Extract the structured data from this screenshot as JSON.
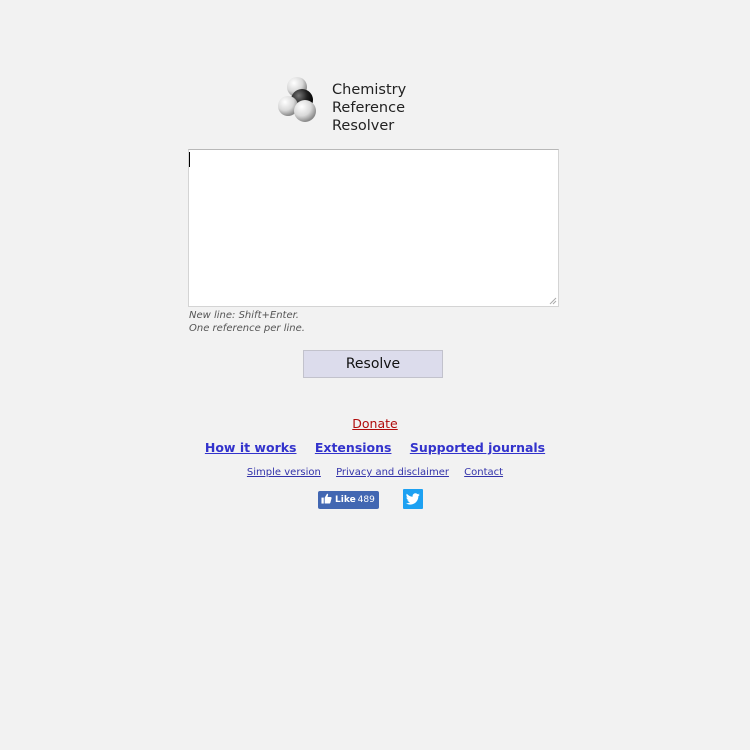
{
  "logo": {
    "line1": "Chemistry",
    "line2": "Reference Resolver"
  },
  "input": {
    "value": "",
    "placeholder": ""
  },
  "hint": {
    "line1": "New line: Shift+Enter.",
    "line2": "One reference per line."
  },
  "resolve_button": "Resolve",
  "donate_link": "Donate",
  "main_nav": [
    "How it works",
    "Extensions",
    "Supported journals"
  ],
  "secondary_nav": [
    "Simple version",
    "Privacy and disclaimer",
    "Contact"
  ],
  "facebook": {
    "label": "Like",
    "count": "489"
  },
  "icons": {
    "logo": "molecule-logo-icon",
    "like": "thumbs-up-icon",
    "twitter": "twitter-bird-icon"
  },
  "colors": {
    "background": "#f2f2f2",
    "donate": "#b10c0c",
    "link": "#3333cc",
    "button": "#dcdcec",
    "facebook": "#4267b2",
    "twitter": "#1da1f2"
  }
}
